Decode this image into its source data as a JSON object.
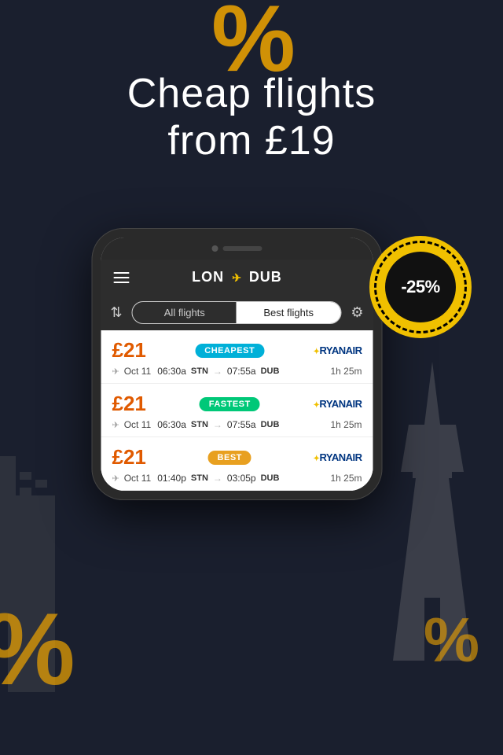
{
  "background": {
    "percent_top": "%",
    "percent_bottom_left": "%",
    "percent_bottom_right": "%"
  },
  "hero": {
    "line1": "Cheap flights",
    "line2": "from £19"
  },
  "badge": {
    "text": "-25%"
  },
  "phone": {
    "header": {
      "menu_icon": "≡",
      "route": "LON",
      "arrow": "→",
      "destination": "DUB"
    },
    "tabs": {
      "all_flights": "All flights",
      "best_flights": "Best flights"
    },
    "flights": [
      {
        "price": "£21",
        "badge": "CHEAPEST",
        "badge_type": "cheapest",
        "airline": "RYANAIR",
        "date": "Oct 11",
        "depart_time": "06:30a",
        "depart_airport": "STN",
        "arrive_time": "07:55a",
        "arrive_airport": "DUB",
        "duration": "1h 25m"
      },
      {
        "price": "£21",
        "badge": "FASTEST",
        "badge_type": "fastest",
        "airline": "RYANAIR",
        "date": "Oct 11",
        "depart_time": "06:30a",
        "depart_airport": "STN",
        "arrive_time": "07:55a",
        "arrive_airport": "DUB",
        "duration": "1h 25m"
      },
      {
        "price": "£21",
        "badge": "BEST",
        "badge_type": "best",
        "airline": "RYANAIR",
        "date": "Oct 11",
        "depart_time": "01:40p",
        "depart_airport": "STN",
        "arrive_time": "03:05p",
        "arrive_airport": "DUB",
        "duration": "1h 25m"
      }
    ]
  }
}
